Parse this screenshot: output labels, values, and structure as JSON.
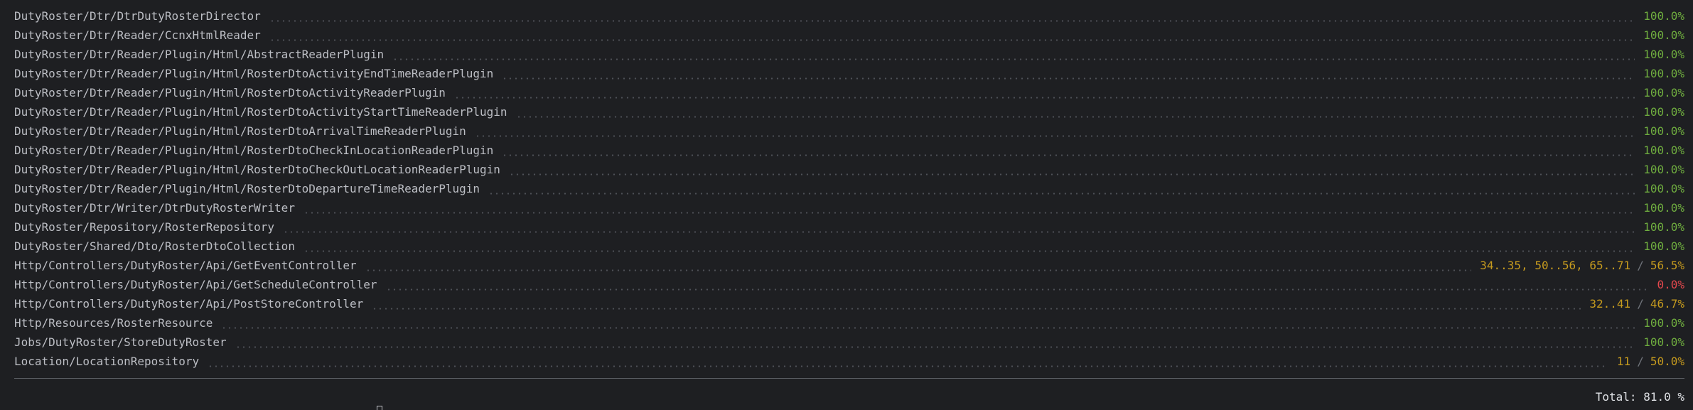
{
  "report": {
    "rows": [
      {
        "path": "DutyRoster/Dtr/DtrDutyRosterDirector",
        "uncovered": "",
        "percent": "100.0%",
        "status": "full"
      },
      {
        "path": "DutyRoster/Dtr/Reader/CcnxHtmlReader",
        "uncovered": "",
        "percent": "100.0%",
        "status": "full"
      },
      {
        "path": "DutyRoster/Dtr/Reader/Plugin/Html/AbstractReaderPlugin",
        "uncovered": "",
        "percent": "100.0%",
        "status": "full"
      },
      {
        "path": "DutyRoster/Dtr/Reader/Plugin/Html/RosterDtoActivityEndTimeReaderPlugin",
        "uncovered": "",
        "percent": "100.0%",
        "status": "full"
      },
      {
        "path": "DutyRoster/Dtr/Reader/Plugin/Html/RosterDtoActivityReaderPlugin",
        "uncovered": "",
        "percent": "100.0%",
        "status": "full"
      },
      {
        "path": "DutyRoster/Dtr/Reader/Plugin/Html/RosterDtoActivityStartTimeReaderPlugin",
        "uncovered": "",
        "percent": "100.0%",
        "status": "full"
      },
      {
        "path": "DutyRoster/Dtr/Reader/Plugin/Html/RosterDtoArrivalTimeReaderPlugin",
        "uncovered": "",
        "percent": "100.0%",
        "status": "full"
      },
      {
        "path": "DutyRoster/Dtr/Reader/Plugin/Html/RosterDtoCheckInLocationReaderPlugin",
        "uncovered": "",
        "percent": "100.0%",
        "status": "full"
      },
      {
        "path": "DutyRoster/Dtr/Reader/Plugin/Html/RosterDtoCheckOutLocationReaderPlugin",
        "uncovered": "",
        "percent": "100.0%",
        "status": "full"
      },
      {
        "path": "DutyRoster/Dtr/Reader/Plugin/Html/RosterDtoDepartureTimeReaderPlugin",
        "uncovered": "",
        "percent": "100.0%",
        "status": "full"
      },
      {
        "path": "DutyRoster/Dtr/Writer/DtrDutyRosterWriter",
        "uncovered": "",
        "percent": "100.0%",
        "status": "full"
      },
      {
        "path": "DutyRoster/Repository/RosterRepository",
        "uncovered": "",
        "percent": "100.0%",
        "status": "full"
      },
      {
        "path": "DutyRoster/Shared/Dto/RosterDtoCollection",
        "uncovered": "",
        "percent": "100.0%",
        "status": "full"
      },
      {
        "path": "Http/Controllers/DutyRoster/Api/GetEventController",
        "uncovered": "34..35, 50..56, 65..71",
        "percent": "56.5%",
        "status": "partial"
      },
      {
        "path": "Http/Controllers/DutyRoster/Api/GetScheduleController",
        "uncovered": "",
        "percent": "0.0%",
        "status": "zero"
      },
      {
        "path": "Http/Controllers/DutyRoster/Api/PostStoreController",
        "uncovered": "32..41",
        "percent": "46.7%",
        "status": "partial"
      },
      {
        "path": "Http/Resources/RosterResource",
        "uncovered": "",
        "percent": "100.0%",
        "status": "full"
      },
      {
        "path": "Jobs/DutyRoster/StoreDutyRoster",
        "uncovered": "",
        "percent": "100.0%",
        "status": "full"
      },
      {
        "path": "Location/LocationRepository",
        "uncovered": "11",
        "percent": "50.0%",
        "status": "partial"
      }
    ],
    "separator": "/",
    "total": "Total: 81.0 %"
  },
  "colors": {
    "background": "#1e1f22",
    "text": "#bcbec4",
    "full": "#6fad3f",
    "partial": "#c59a1e",
    "zero": "#e5484d"
  }
}
